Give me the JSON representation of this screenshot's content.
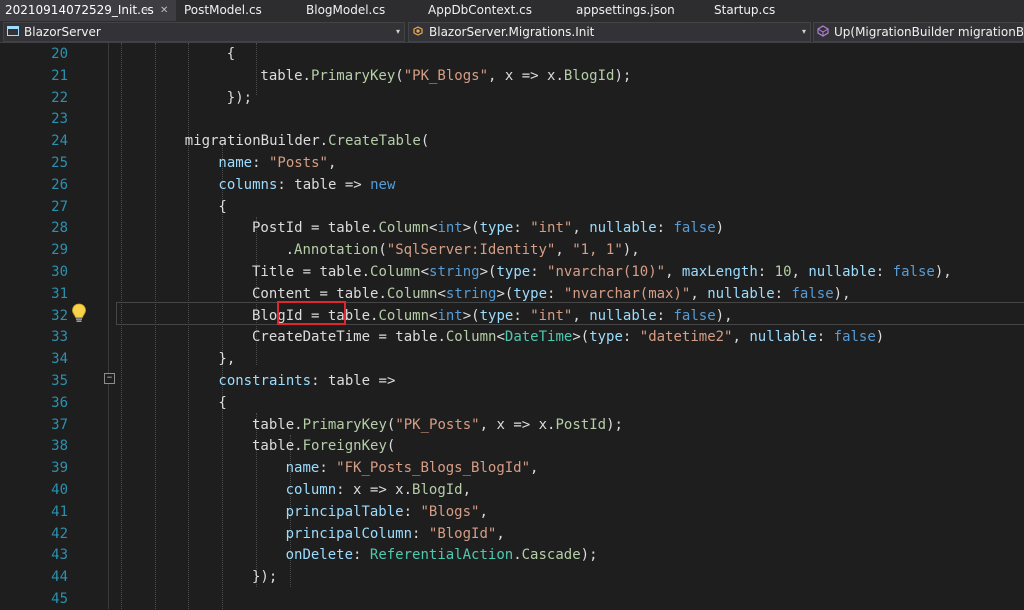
{
  "tabs": [
    {
      "label": "20210914072529_Init.cs",
      "active": true,
      "pin": "⊸",
      "close": "✕"
    },
    {
      "label": "PostModel.cs"
    },
    {
      "label": "BlogModel.cs"
    },
    {
      "label": "AppDbContext.cs"
    },
    {
      "label": "appsettings.json"
    },
    {
      "label": "Startup.cs"
    }
  ],
  "navbar": {
    "project": "BlazorServer",
    "class": "BlazorServer.Migrations.Init",
    "member": "Up(MigrationBuilder migrationBuild",
    "arrow": "▾"
  },
  "fold_symbol": "−",
  "icons": {
    "lightbulb": "lightbulb-icon"
  },
  "colors": {
    "background": "#1e1e1e",
    "line_number": "#2b91af",
    "keyword": "#569cd6",
    "string": "#d69d85",
    "type": "#4ec9b0",
    "parameter": "#9cdcfe",
    "member": "#b5cea8",
    "highlight_box": "#e0272f"
  },
  "lines": [
    {
      "n": "20",
      "tokens": [
        [
          "{",
          "plain"
        ]
      ]
    },
    {
      "n": "21",
      "tokens": [
        [
          "table",
          "plain"
        ],
        [
          ".",
          "plain"
        ],
        [
          "PrimaryKey",
          "ident"
        ],
        [
          "(",
          "plain"
        ],
        [
          "\"PK_Blogs\"",
          "str"
        ],
        [
          ", x => x.",
          "plain"
        ],
        [
          "BlogId",
          "ident"
        ],
        [
          ");",
          "plain"
        ]
      ]
    },
    {
      "n": "22",
      "tokens": [
        [
          "});",
          "plain"
        ]
      ]
    },
    {
      "n": "23",
      "tokens": []
    },
    {
      "n": "24",
      "tokens": [
        [
          "migrationBuilder",
          "plain"
        ],
        [
          ".",
          "plain"
        ],
        [
          "CreateTable",
          "ident"
        ],
        [
          "(",
          "plain"
        ]
      ]
    },
    {
      "n": "25",
      "tokens": [
        [
          "name",
          "param"
        ],
        [
          ": ",
          "plain"
        ],
        [
          "\"Posts\"",
          "str"
        ],
        [
          ",",
          "plain"
        ]
      ]
    },
    {
      "n": "26",
      "tokens": [
        [
          "columns",
          "param"
        ],
        [
          ": table => ",
          "plain"
        ],
        [
          "new",
          "kw"
        ]
      ]
    },
    {
      "n": "27",
      "tokens": [
        [
          "{",
          "plain"
        ]
      ]
    },
    {
      "n": "28",
      "tokens": [
        [
          "PostId",
          "plain"
        ],
        [
          " = table.",
          "plain"
        ],
        [
          "Column",
          "ident"
        ],
        [
          "<",
          "plain"
        ],
        [
          "int",
          "kw"
        ],
        [
          ">(",
          "plain"
        ],
        [
          "type",
          "param"
        ],
        [
          ": ",
          "plain"
        ],
        [
          "\"int\"",
          "str"
        ],
        [
          ", ",
          "plain"
        ],
        [
          "nullable",
          "param"
        ],
        [
          ": ",
          "plain"
        ],
        [
          "false",
          "kw"
        ],
        [
          ")",
          "plain"
        ]
      ]
    },
    {
      "n": "29",
      "tokens": [
        [
          ".",
          "plain"
        ],
        [
          "Annotation",
          "ident"
        ],
        [
          "(",
          "plain"
        ],
        [
          "\"SqlServer:Identity\"",
          "str"
        ],
        [
          ", ",
          "plain"
        ],
        [
          "\"1, 1\"",
          "str"
        ],
        [
          "),",
          "plain"
        ]
      ]
    },
    {
      "n": "30",
      "tokens": [
        [
          "Title",
          "plain"
        ],
        [
          " = table.",
          "plain"
        ],
        [
          "Column",
          "ident"
        ],
        [
          "<",
          "plain"
        ],
        [
          "string",
          "kw"
        ],
        [
          ">(",
          "plain"
        ],
        [
          "type",
          "param"
        ],
        [
          ": ",
          "plain"
        ],
        [
          "\"nvarchar(10)\"",
          "str"
        ],
        [
          ", ",
          "plain"
        ],
        [
          "maxLength",
          "param"
        ],
        [
          ": ",
          "plain"
        ],
        [
          "10",
          "num"
        ],
        [
          ", ",
          "plain"
        ],
        [
          "nullable",
          "param"
        ],
        [
          ": ",
          "plain"
        ],
        [
          "false",
          "kw"
        ],
        [
          "),",
          "plain"
        ]
      ]
    },
    {
      "n": "31",
      "tokens": [
        [
          "Content",
          "plain"
        ],
        [
          " = table.",
          "plain"
        ],
        [
          "Column",
          "ident"
        ],
        [
          "<",
          "plain"
        ],
        [
          "string",
          "kw"
        ],
        [
          ">(",
          "plain"
        ],
        [
          "type",
          "param"
        ],
        [
          ": ",
          "plain"
        ],
        [
          "\"nvarchar(max)\"",
          "str"
        ],
        [
          ", ",
          "plain"
        ],
        [
          "nullable",
          "param"
        ],
        [
          ": ",
          "plain"
        ],
        [
          "false",
          "kw"
        ],
        [
          "),",
          "plain"
        ]
      ]
    },
    {
      "n": "32",
      "tokens": [
        [
          "BlogId",
          "plain"
        ],
        [
          " = table.",
          "plain"
        ],
        [
          "Column",
          "ident"
        ],
        [
          "<",
          "plain"
        ],
        [
          "int",
          "kw"
        ],
        [
          ">(",
          "plain"
        ],
        [
          "type",
          "param"
        ],
        [
          ": ",
          "plain"
        ],
        [
          "\"int\"",
          "str"
        ],
        [
          ", ",
          "plain"
        ],
        [
          "nullable",
          "param"
        ],
        [
          ": ",
          "plain"
        ],
        [
          "false",
          "kw"
        ],
        [
          "),",
          "plain"
        ]
      ]
    },
    {
      "n": "33",
      "tokens": [
        [
          "CreateDateTime",
          "plain"
        ],
        [
          " = table.",
          "plain"
        ],
        [
          "Column",
          "ident"
        ],
        [
          "<",
          "plain"
        ],
        [
          "DateTime",
          "type"
        ],
        [
          ">(",
          "plain"
        ],
        [
          "type",
          "param"
        ],
        [
          ": ",
          "plain"
        ],
        [
          "\"datetime2\"",
          "str"
        ],
        [
          ", ",
          "plain"
        ],
        [
          "nullable",
          "param"
        ],
        [
          ": ",
          "plain"
        ],
        [
          "false",
          "kw"
        ],
        [
          ")",
          "plain"
        ]
      ]
    },
    {
      "n": "34",
      "tokens": [
        [
          "},",
          "plain"
        ]
      ]
    },
    {
      "n": "35",
      "tokens": [
        [
          "constraints",
          "param"
        ],
        [
          ": table =>",
          "plain"
        ]
      ]
    },
    {
      "n": "36",
      "tokens": [
        [
          "{",
          "plain"
        ]
      ]
    },
    {
      "n": "37",
      "tokens": [
        [
          "table",
          "plain"
        ],
        [
          ".",
          "plain"
        ],
        [
          "PrimaryKey",
          "ident"
        ],
        [
          "(",
          "plain"
        ],
        [
          "\"PK_Posts\"",
          "str"
        ],
        [
          ", x => x.",
          "plain"
        ],
        [
          "PostId",
          "ident"
        ],
        [
          ");",
          "plain"
        ]
      ]
    },
    {
      "n": "38",
      "tokens": [
        [
          "table",
          "plain"
        ],
        [
          ".",
          "plain"
        ],
        [
          "ForeignKey",
          "ident"
        ],
        [
          "(",
          "plain"
        ]
      ]
    },
    {
      "n": "39",
      "tokens": [
        [
          "name",
          "param"
        ],
        [
          ": ",
          "plain"
        ],
        [
          "\"FK_Posts_Blogs_BlogId\"",
          "str"
        ],
        [
          ",",
          "plain"
        ]
      ]
    },
    {
      "n": "40",
      "tokens": [
        [
          "column",
          "param"
        ],
        [
          ": x => x.",
          "plain"
        ],
        [
          "BlogId",
          "ident"
        ],
        [
          ",",
          "plain"
        ]
      ]
    },
    {
      "n": "41",
      "tokens": [
        [
          "principalTable",
          "param"
        ],
        [
          ": ",
          "plain"
        ],
        [
          "\"Blogs\"",
          "str"
        ],
        [
          ",",
          "plain"
        ]
      ]
    },
    {
      "n": "42",
      "tokens": [
        [
          "principalColumn",
          "param"
        ],
        [
          ": ",
          "plain"
        ],
        [
          "\"BlogId\"",
          "str"
        ],
        [
          ",",
          "plain"
        ]
      ]
    },
    {
      "n": "43",
      "tokens": [
        [
          "onDelete",
          "param"
        ],
        [
          ": ",
          "plain"
        ],
        [
          "ReferentialAction",
          "type"
        ],
        [
          ".",
          "plain"
        ],
        [
          "Cascade",
          "ident"
        ],
        [
          ");",
          "plain"
        ]
      ]
    },
    {
      "n": "44",
      "tokens": [
        [
          "});",
          "plain"
        ]
      ]
    },
    {
      "n": "45",
      "tokens": []
    }
  ]
}
